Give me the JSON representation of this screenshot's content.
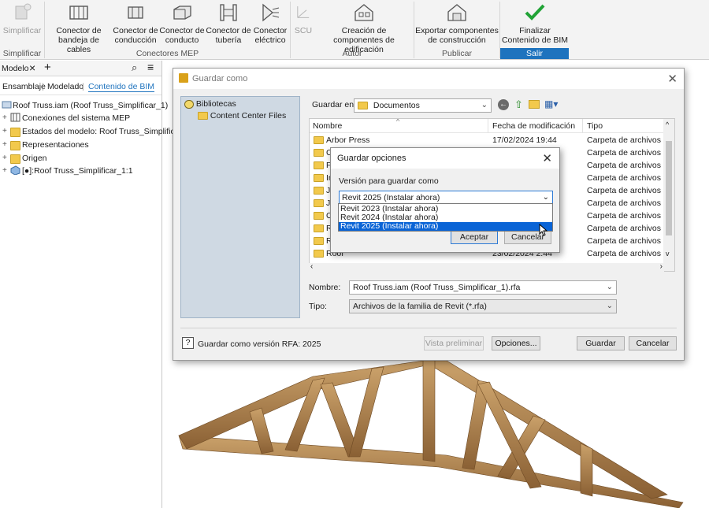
{
  "ribbon": {
    "buttons": [
      {
        "label": "Simplificar",
        "icon": "simplify-icon",
        "disabled": true
      },
      {
        "label": "Conector de bandeja de cables",
        "icon": "cable-tray-connector-icon"
      },
      {
        "label": "Conector de conducción",
        "icon": "duct-connector-icon"
      },
      {
        "label": "Conector de conducto",
        "icon": "conduit-connector-icon"
      },
      {
        "label": "Conector de tubería",
        "icon": "pipe-connector-icon"
      },
      {
        "label": "Conector eléctrico",
        "icon": "electrical-connector-icon"
      },
      {
        "label": "SCU",
        "icon": "ucs-icon",
        "disabled": true
      },
      {
        "label": "Creación de componentes de edificación",
        "icon": "building-component-icon"
      },
      {
        "label": "Exportar componentes de construcción",
        "icon": "export-building-icon"
      },
      {
        "label": "Finalizar Contenido de BIM",
        "icon": "checkmark-icon"
      }
    ],
    "groups": [
      "Simplificar",
      "Conectores MEP",
      "Autor",
      "Publicar",
      "Salir"
    ]
  },
  "browser": {
    "tab": "Modelo",
    "subtabs": [
      "Ensamblaje",
      "Modelado",
      "Contenido de BIM"
    ],
    "tree": [
      {
        "label": "Roof Truss.iam (Roof Truss_Simplificar_1)",
        "icon": "assembly-icon"
      },
      {
        "label": "Conexiones del sistema MEP",
        "icon": "mep-icon"
      },
      {
        "label": "Estados del modelo: Roof Truss_Simplificar_",
        "icon": "folder-icon"
      },
      {
        "label": "Representaciones",
        "icon": "folder-icon"
      },
      {
        "label": "Origen",
        "icon": "folder-icon"
      },
      {
        "label": "[●]:Roof Truss_Simplificar_1:1",
        "icon": "part-icon"
      }
    ]
  },
  "save_dialog": {
    "title": "Guardar como",
    "libraries": "Bibliotecas",
    "content_center": "Content Center Files",
    "save_in_label": "Guardar en:",
    "save_in_value": "Documentos",
    "columns": [
      "Nombre",
      "Fecha de modificación",
      "Tipo"
    ],
    "files": [
      {
        "name": "Arbor Press",
        "date": "17/02/2024 19:44",
        "type": "Carpeta de archivos"
      },
      {
        "name": "C",
        "date": "",
        "type": "Carpeta de archivos"
      },
      {
        "name": "F",
        "date": "",
        "type": "Carpeta de archivos"
      },
      {
        "name": "In",
        "date": "",
        "type": "Carpeta de archivos"
      },
      {
        "name": "Je",
        "date": "",
        "type": "Carpeta de archivos"
      },
      {
        "name": "JP",
        "date": "",
        "type": "Carpeta de archivos"
      },
      {
        "name": "O",
        "date": "",
        "type": "Carpeta de archivos"
      },
      {
        "name": "R",
        "date": "",
        "type": "Carpeta de archivos"
      },
      {
        "name": "R",
        "date": "",
        "type": "Carpeta de archivos"
      },
      {
        "name": "Roof",
        "date": "23/02/2024 2:44",
        "type": "Carpeta de archivos"
      }
    ],
    "name_label": "Nombre:",
    "name_value": "Roof Truss.iam (Roof Truss_Simplificar_1).rfa",
    "type_label": "Tipo:",
    "type_value": "Archivos de la familia de Revit (*.rfa)",
    "rfa_version": "Guardar como versión RFA: 2025",
    "preview_btn": "Vista preliminar",
    "options_btn": "Opciones...",
    "save_btn": "Guardar",
    "cancel_btn": "Cancelar"
  },
  "options_dialog": {
    "title": "Guardar opciones",
    "version_label": "Versión para guardar como",
    "selected": "Revit 2025 (Instalar ahora)",
    "options": [
      "Revit 2023 (Instalar ahora)",
      "Revit 2024 (Instalar ahora)",
      "Revit 2025 (Instalar ahora)"
    ],
    "accept_btn": "Aceptar",
    "cancel_btn": "Cancelar"
  }
}
